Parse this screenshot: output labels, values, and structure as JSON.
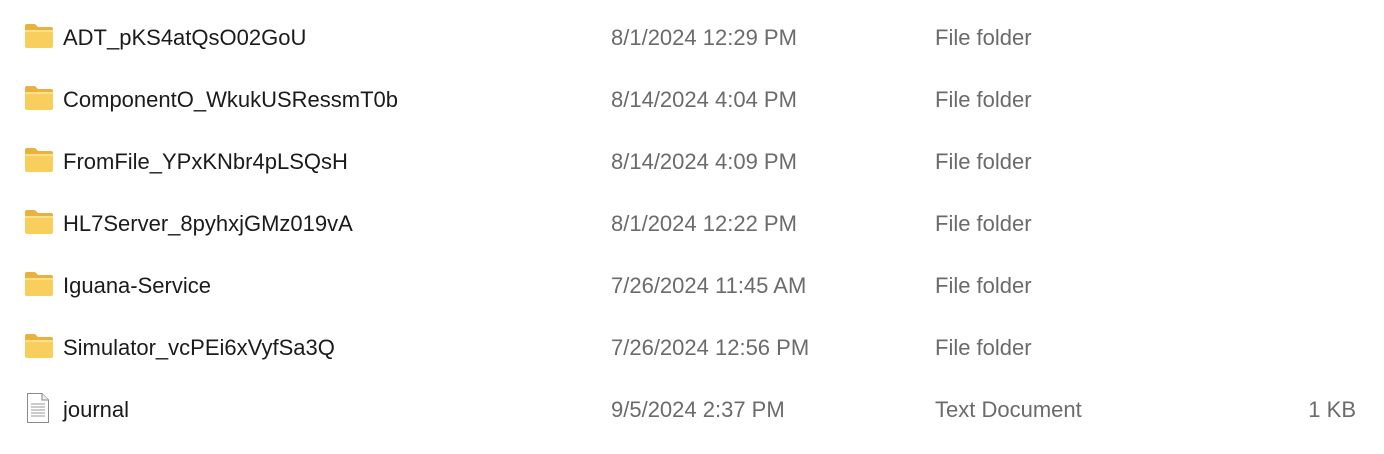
{
  "files": [
    {
      "name": "ADT_pKS4atQsO02GoU",
      "date_modified": "8/1/2024 12:29 PM",
      "type": "File folder",
      "size": "",
      "icon": "folder-icon"
    },
    {
      "name": "ComponentO_WkukUSRessmT0b",
      "date_modified": "8/14/2024 4:04 PM",
      "type": "File folder",
      "size": "",
      "icon": "folder-icon"
    },
    {
      "name": "FromFile_YPxKNbr4pLSQsH",
      "date_modified": "8/14/2024 4:09 PM",
      "type": "File folder",
      "size": "",
      "icon": "folder-icon"
    },
    {
      "name": "HL7Server_8pyhxjGMz019vA",
      "date_modified": "8/1/2024 12:22 PM",
      "type": "File folder",
      "size": "",
      "icon": "folder-icon"
    },
    {
      "name": "Iguana-Service",
      "date_modified": "7/26/2024 11:45 AM",
      "type": "File folder",
      "size": "",
      "icon": "folder-icon"
    },
    {
      "name": "Simulator_vcPEi6xVyfSa3Q",
      "date_modified": "7/26/2024 12:56 PM",
      "type": "File folder",
      "size": "",
      "icon": "folder-icon"
    },
    {
      "name": "journal",
      "date_modified": "9/5/2024 2:37 PM",
      "type": "Text Document",
      "size": "1 KB",
      "icon": "text-document-icon"
    }
  ],
  "colors": {
    "folder_body": "#f8cf5c",
    "folder_tab": "#e9b23f",
    "primary_text": "#1b1b1b",
    "secondary_text": "#6b6b6b"
  }
}
